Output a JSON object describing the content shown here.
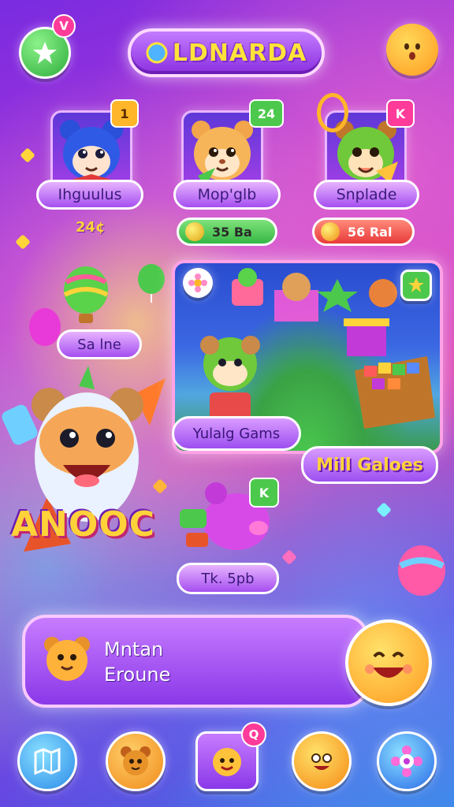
{
  "header": {
    "title": "LDNARDA",
    "left_badge": "V"
  },
  "characters": [
    {
      "name": "Ihguulus",
      "badge": "1",
      "sub_label": "24¢"
    },
    {
      "name": "Mop'glb",
      "badge": "24",
      "coins": "35 Ba"
    },
    {
      "name": "Snplade",
      "badge": "K",
      "coins": "56 Ral"
    }
  ],
  "side_tag": {
    "label": "Sa lne"
  },
  "hero_title": "ANOOC",
  "game_panel": {
    "label": "Yulalg Gams",
    "corner_label": "Mill Galoes"
  },
  "pet_card": {
    "badge": "K",
    "label": "Tk. 5pb"
  },
  "banner": {
    "line1": "Mntan",
    "line2": "Eroune"
  },
  "nav": {
    "items": [
      {
        "icon": "map-icon"
      },
      {
        "icon": "bear-face-icon"
      },
      {
        "icon": "chick-face-icon",
        "badge": "Q"
      },
      {
        "icon": "smiley-face-icon"
      },
      {
        "icon": "flower-gear-icon"
      }
    ]
  },
  "colors": {
    "accent_gold": "#ffd33a",
    "purple": "#8a38e8",
    "green_badge": "#4cc94c",
    "pink_badge": "#ff3b9a"
  }
}
